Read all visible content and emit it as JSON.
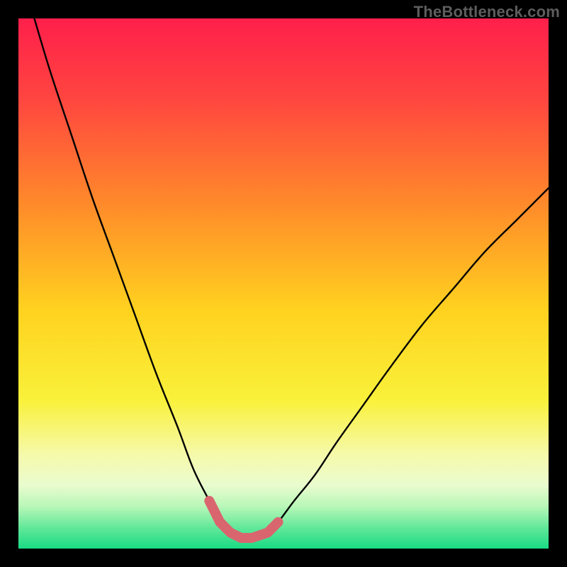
{
  "watermark": "TheBottleneck.com",
  "chart_data": {
    "type": "line",
    "title": "",
    "xlabel": "",
    "ylabel": "",
    "xlim": [
      0,
      100
    ],
    "ylim": [
      0,
      100
    ],
    "grid": false,
    "legend": false,
    "series": [
      {
        "name": "bottleneck-curve",
        "x": [
          3,
          6,
          10,
          14,
          18,
          22,
          26,
          30,
          33,
          36,
          38,
          40,
          42,
          44,
          47,
          49,
          52,
          56,
          60,
          65,
          70,
          76,
          82,
          88,
          94,
          100
        ],
        "values": [
          100,
          90,
          78,
          66,
          55,
          44,
          33,
          23,
          15,
          9,
          5,
          3,
          2,
          2,
          3,
          5,
          9,
          14,
          20,
          27,
          34,
          42,
          49,
          56,
          62,
          68
        ]
      }
    ],
    "annotations": [
      {
        "name": "valley-highlight",
        "type": "segment",
        "color": "#d9666f",
        "x": [
          36,
          38,
          40,
          42,
          44,
          47,
          49
        ],
        "values": [
          9,
          5,
          3,
          2,
          2,
          3,
          5
        ]
      }
    ],
    "background_gradient_stops": [
      {
        "offset": 0.0,
        "color": "#ff1f4b"
      },
      {
        "offset": 0.15,
        "color": "#ff4540"
      },
      {
        "offset": 0.35,
        "color": "#ff8a2a"
      },
      {
        "offset": 0.55,
        "color": "#ffd21f"
      },
      {
        "offset": 0.72,
        "color": "#f9f13a"
      },
      {
        "offset": 0.82,
        "color": "#f6f9a8"
      },
      {
        "offset": 0.88,
        "color": "#eafccf"
      },
      {
        "offset": 0.92,
        "color": "#b9f7b8"
      },
      {
        "offset": 0.96,
        "color": "#63e89a"
      },
      {
        "offset": 1.0,
        "color": "#19db84"
      }
    ]
  }
}
